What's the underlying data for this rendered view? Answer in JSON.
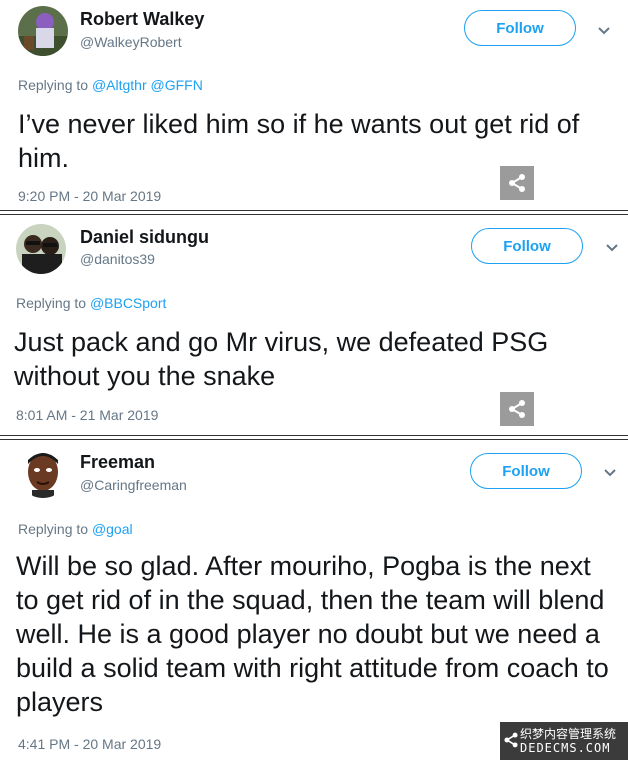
{
  "tweets": [
    {
      "name": "Robert Walkey",
      "handle": "@WalkeyRobert",
      "follow_label": "Follow",
      "replying_prefix": "Replying to ",
      "mentions": "@Altgthr @GFFN",
      "text": "I’ve never liked him so if he wants out get rid of him.",
      "timestamp": "9:20 PM - 20 Mar 2019"
    },
    {
      "name": "Daniel sidungu",
      "handle": "@danitos39",
      "follow_label": "Follow",
      "replying_prefix": "Replying to ",
      "mentions": "@BBCSport",
      "text": "Just pack and go Mr virus, we defeated PSG without you the snake",
      "timestamp": "8:01 AM - 21 Mar 2019"
    },
    {
      "name": "Freeman",
      "handle": "@Caringfreeman",
      "follow_label": "Follow",
      "replying_prefix": "Replying to ",
      "mentions": "@goal",
      "text": "Will be so glad. After mouriho, Pogba is the next to get rid of in the squad, then the team will blend well. He is a good player no doubt but we need a build a solid team with right attitude from coach to players",
      "timestamp": "4:41 PM - 20 Mar 2019"
    }
  ],
  "watermark": {
    "line1": "织梦内容管理系统",
    "line2": "DEDECMS.COM"
  },
  "colors": {
    "accent": "#1da1f2",
    "muted": "#657786",
    "text": "#14171a",
    "share_bg": "#9b9b9b"
  },
  "icons": {
    "chevron": "chevron-down-icon",
    "share": "share-icon"
  }
}
